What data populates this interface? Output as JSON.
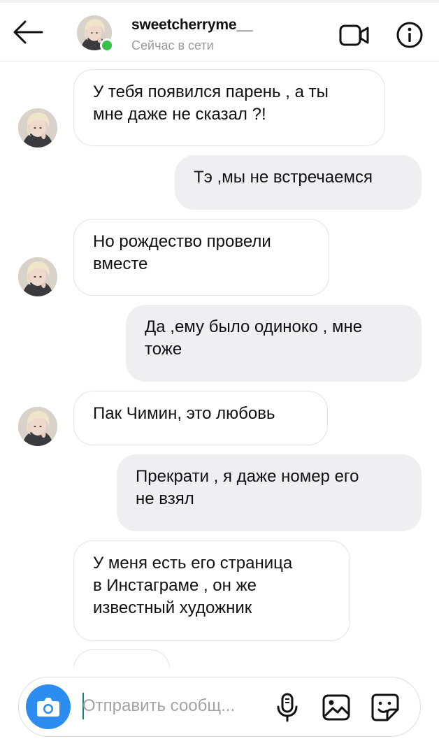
{
  "header": {
    "username": "sweetcherryme__",
    "status": "Сейчас в сети"
  },
  "colors": {
    "online": "#37c24b",
    "camera_button": "#2d8cf0",
    "outgoing_bubble": "#efeff1"
  },
  "icons": [
    "back-arrow-icon",
    "video-call-icon",
    "info-icon",
    "camera-icon",
    "microphone-icon",
    "gallery-icon",
    "sticker-icon"
  ],
  "messages": [
    {
      "direction": "incoming",
      "text": "У тебя появился парень , а ты\nмне даже не сказал ?!"
    },
    {
      "direction": "outgoing",
      "text": "Тэ ,мы не встречаемся"
    },
    {
      "direction": "incoming",
      "text": "Но рождество провели\nвместе"
    },
    {
      "direction": "outgoing",
      "text": "Да ,ему было одиноко , мне\nтоже"
    },
    {
      "direction": "incoming",
      "text": "Пак Чимин, это любовь"
    },
    {
      "direction": "outgoing",
      "text": "Прекрати , я даже номер его\nне взял"
    },
    {
      "direction": "incoming",
      "text": "У меня есть его страница\nв Инстаграме , он же\nизвестный художник"
    }
  ],
  "composer": {
    "placeholder": "Отправить сообщ..."
  }
}
